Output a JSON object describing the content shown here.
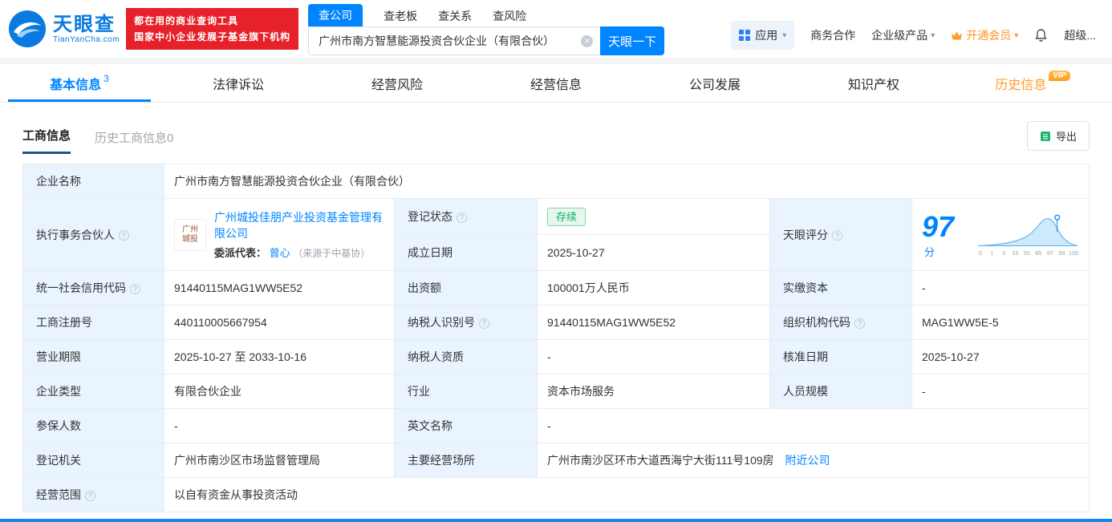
{
  "colors": {
    "accent_blue": "#0084ff",
    "brand_red": "#e62129",
    "vip_orange": "#ff9a2e",
    "status_green": "#00b365",
    "label_cell_bg": "#e9f4fe"
  },
  "icons": {
    "help": "?",
    "caret_down": "▾",
    "clear": "×"
  },
  "header": {
    "logo_title": "天眼查",
    "logo_subtitle": "TianYanCha.com",
    "slogan_line1": "都在用的商业查询工具",
    "slogan_line2": "国家中小企业发展子基金旗下机构",
    "search_tabs": [
      {
        "label": "查公司"
      },
      {
        "label": "查老板"
      },
      {
        "label": "查关系"
      },
      {
        "label": "查风险"
      }
    ],
    "search_value": "广州市南方智慧能源投资合伙企业（有限合伙）",
    "search_button": "天眼一下",
    "nav_right": {
      "apps": "应用",
      "cooperation": "商务合作",
      "enterprise": "企业级产品",
      "vip": "开通会员",
      "super": "超级..."
    }
  },
  "tabs": [
    {
      "label": "基本信息",
      "count": "3"
    },
    {
      "label": "法律诉讼"
    },
    {
      "label": "经营风险"
    },
    {
      "label": "经营信息"
    },
    {
      "label": "公司发展"
    },
    {
      "label": "知识产权"
    },
    {
      "label": "历史信息",
      "badge": "VIP"
    }
  ],
  "subtabs": {
    "business": "工商信息",
    "history": "历史工商信息0",
    "export": "导出"
  },
  "score": {
    "label": "天眼评分",
    "value": "97",
    "unit": "分",
    "ticks": [
      "0",
      "1",
      "3",
      "15",
      "50",
      "85",
      "97",
      "99",
      "100"
    ]
  },
  "info": {
    "company_name": {
      "label": "企业名称",
      "value": "广州市南方智慧能源投资合伙企业（有限合伙）"
    },
    "executive_partner": {
      "label": "执行事务合伙人",
      "logo_text": "广州城投",
      "company": "广州城投佳朋产业投资基金管理有限公司",
      "delegate_label": "委派代表：",
      "delegate_name": "曾心",
      "delegate_source": "（来源于中基协）"
    },
    "reg_status": {
      "label": "登记状态",
      "value": "存续"
    },
    "establish_date": {
      "label": "成立日期",
      "value": "2025-10-27"
    },
    "credit_code": {
      "label": "统一社会信用代码",
      "value": "91440115MAG1WW5E52"
    },
    "capital": {
      "label": "出资额",
      "value": "100001万人民币"
    },
    "paid_capital": {
      "label": "实缴资本",
      "value": "-"
    },
    "reg_no": {
      "label": "工商注册号",
      "value": "440110005667954"
    },
    "taxpayer_no": {
      "label": "纳税人识别号",
      "value": "91440115MAG1WW5E52"
    },
    "org_code": {
      "label": "组织机构代码",
      "value": "MAG1WW5E-5"
    },
    "business_term": {
      "label": "营业期限",
      "value": "2025-10-27 至 2033-10-16"
    },
    "taxpayer_quality": {
      "label": "纳税人资质",
      "value": "-"
    },
    "approval_date": {
      "label": "核准日期",
      "value": "2025-10-27"
    },
    "company_type": {
      "label": "企业类型",
      "value": "有限合伙企业"
    },
    "industry": {
      "label": "行业",
      "value": "资本市场服务"
    },
    "staff_size": {
      "label": "人员规模",
      "value": "-"
    },
    "insured_num": {
      "label": "参保人数",
      "value": "-"
    },
    "english_name": {
      "label": "英文名称",
      "value": "-"
    },
    "reg_authority": {
      "label": "登记机关",
      "value": "广州市南沙区市场监督管理局"
    },
    "main_premises": {
      "label": "主要经营场所",
      "value": "广州市南沙区环市大道西海宁大街111号109房",
      "nearby_link": "附近公司"
    },
    "business_scope": {
      "label": "经营范围",
      "value": "以自有资金从事投资活动"
    }
  }
}
